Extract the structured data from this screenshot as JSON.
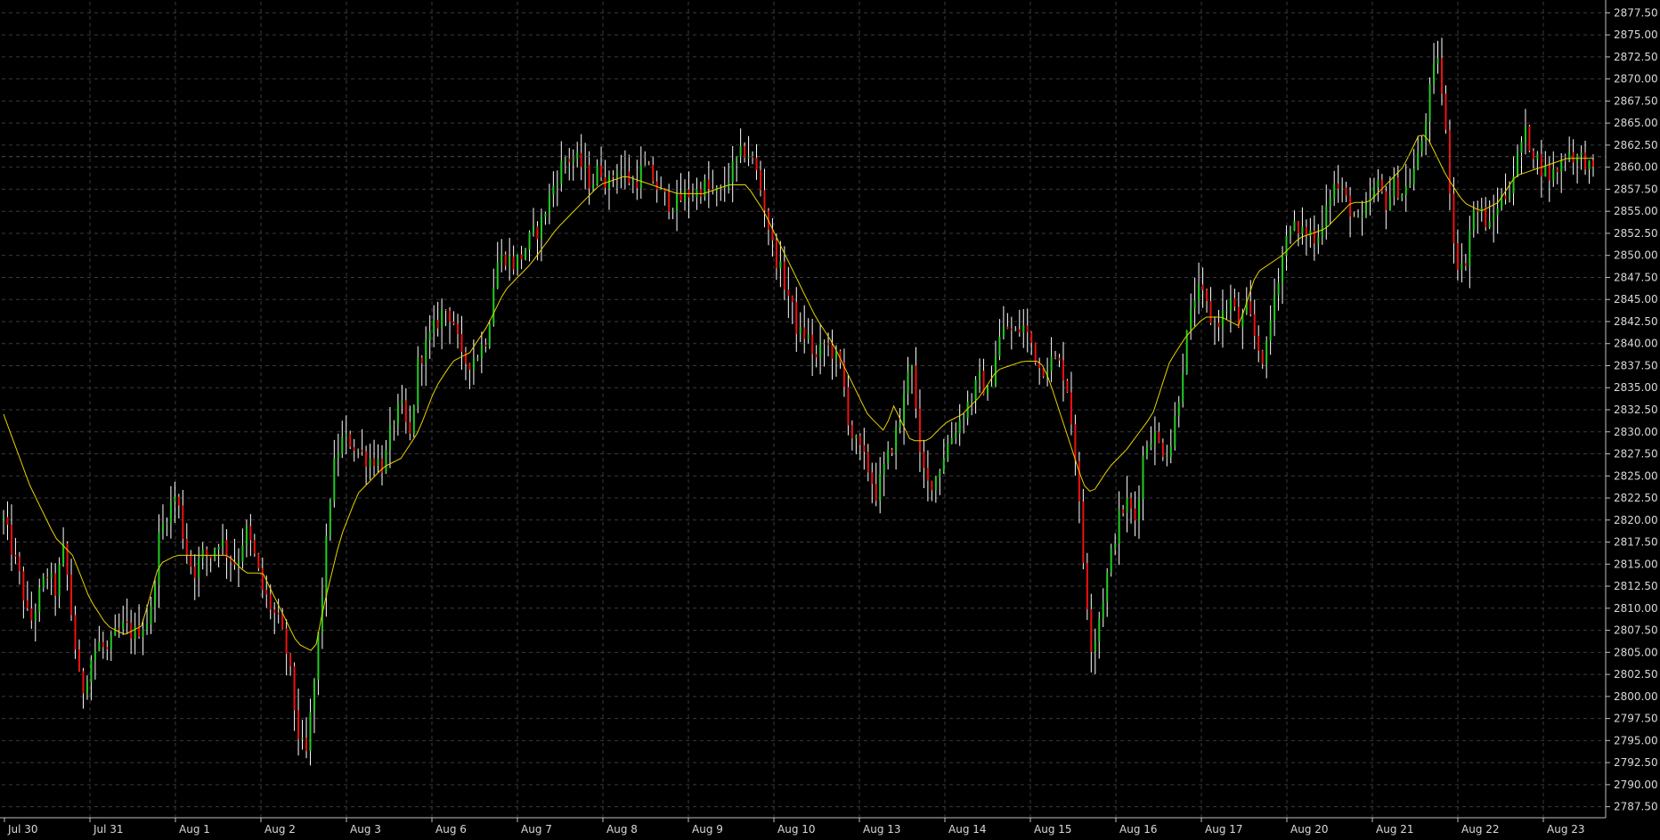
{
  "colors": {
    "background": "#000000",
    "grid": "#3a3a3a",
    "axis": "#c0c0c0",
    "text": "#d8d8d8",
    "bull_candle": "#22cc22",
    "bear_candle": "#ee1111",
    "wick": "#ffffff",
    "moving_average": "#e6d200",
    "last_price_line": "#555555"
  },
  "chart_data": {
    "type": "candlestick",
    "title": "",
    "xlabel": "",
    "ylabel": "",
    "ylim": [
      2786.25,
      2878.75
    ],
    "grid": true,
    "price_axis_side": "right",
    "last_price": 2861.2,
    "x_tick_labels": [
      "Jul 30",
      "Jul 31",
      "Aug 1",
      "Aug 2",
      "Aug 3",
      "Aug 6",
      "Aug 7",
      "Aug 8",
      "Aug 9",
      "Aug 10",
      "Aug 13",
      "Aug 14",
      "Aug 15",
      "Aug 16",
      "Aug 17",
      "Aug 20",
      "Aug 21",
      "Aug 22",
      "Aug 23"
    ],
    "y_tick_labels": [
      "2877.50",
      "2875.00",
      "2872.50",
      "2870.00",
      "2867.50",
      "2865.00",
      "2862.50",
      "2860.00",
      "2857.50",
      "2855.00",
      "2852.50",
      "2850.00",
      "2847.50",
      "2845.00",
      "2842.50",
      "2840.00",
      "2837.50",
      "2835.00",
      "2832.50",
      "2830.00",
      "2827.50",
      "2825.00",
      "2822.50",
      "2820.00",
      "2817.50",
      "2815.00",
      "2812.50",
      "2810.00",
      "2807.50",
      "2805.00",
      "2802.50",
      "2800.00",
      "2797.50",
      "2795.00",
      "2792.50",
      "2790.00",
      "2787.50"
    ],
    "y_tick_values": [
      2877.5,
      2875,
      2872.5,
      2870,
      2867.5,
      2865,
      2862.5,
      2860,
      2857.5,
      2855,
      2852.5,
      2850,
      2847.5,
      2845,
      2842.5,
      2840,
      2837.5,
      2835,
      2832.5,
      2830,
      2827.5,
      2825,
      2822.5,
      2820,
      2817.5,
      2815,
      2812.5,
      2810,
      2807.5,
      2805,
      2802.5,
      2800,
      2797.5,
      2795,
      2792.5,
      2790,
      2787.5
    ],
    "close_path": [
      [
        0,
        2820
      ],
      [
        2,
        2813
      ],
      [
        3,
        2808
      ],
      [
        5,
        2814
      ],
      [
        6,
        2812
      ],
      [
        7,
        2817
      ],
      [
        8,
        2808
      ],
      [
        9,
        2800
      ],
      [
        10,
        2804
      ],
      [
        11,
        2806
      ],
      [
        12,
        2805
      ],
      [
        13,
        2807
      ],
      [
        14,
        2808
      ],
      [
        15,
        2807
      ],
      [
        16,
        2808
      ],
      [
        17,
        2809
      ],
      [
        18,
        2818
      ],
      [
        19,
        2821
      ],
      [
        20,
        2823
      ],
      [
        21,
        2817
      ],
      [
        22,
        2814
      ],
      [
        23,
        2816
      ],
      [
        24,
        2816
      ],
      [
        25,
        2818
      ],
      [
        26,
        2816
      ],
      [
        27,
        2815
      ],
      [
        28,
        2819
      ],
      [
        29,
        2816
      ],
      [
        30,
        2812
      ],
      [
        31,
        2810
      ],
      [
        32,
        2808
      ],
      [
        33,
        2804
      ],
      [
        34,
        2796
      ],
      [
        35,
        2793
      ],
      [
        36,
        2802
      ],
      [
        37,
        2813
      ],
      [
        38,
        2825
      ],
      [
        39,
        2829
      ],
      [
        40,
        2829
      ],
      [
        41,
        2828
      ],
      [
        42,
        2827
      ],
      [
        43,
        2827
      ],
      [
        44,
        2826
      ],
      [
        45,
        2831
      ],
      [
        46,
        2833
      ],
      [
        47,
        2829
      ],
      [
        48,
        2838
      ],
      [
        49,
        2840
      ],
      [
        50,
        2842
      ],
      [
        51,
        2844
      ],
      [
        52,
        2843
      ],
      [
        53,
        2838
      ],
      [
        54,
        2838
      ],
      [
        55,
        2839
      ],
      [
        56,
        2841
      ],
      [
        57,
        2849
      ],
      [
        58,
        2850
      ],
      [
        59,
        2849
      ],
      [
        60,
        2850
      ],
      [
        61,
        2852
      ],
      [
        62,
        2853
      ],
      [
        63,
        2856
      ],
      [
        64,
        2859
      ],
      [
        65,
        2861
      ],
      [
        66,
        2861
      ],
      [
        67,
        2860
      ],
      [
        68,
        2858
      ],
      [
        69,
        2860
      ],
      [
        70,
        2858
      ],
      [
        71,
        2860
      ],
      [
        72,
        2859
      ],
      [
        73,
        2858
      ],
      [
        74,
        2860
      ],
      [
        75,
        2859
      ],
      [
        76,
        2857
      ],
      [
        77,
        2856
      ],
      [
        78,
        2856
      ],
      [
        79,
        2857
      ],
      [
        80,
        2857
      ],
      [
        81,
        2858
      ],
      [
        82,
        2857
      ],
      [
        83,
        2857
      ],
      [
        84,
        2859
      ],
      [
        85,
        2861
      ],
      [
        86,
        2862
      ],
      [
        87,
        2860
      ],
      [
        88,
        2856
      ],
      [
        89,
        2851
      ],
      [
        90,
        2848
      ],
      [
        91,
        2845
      ],
      [
        92,
        2841
      ],
      [
        93,
        2841
      ],
      [
        94,
        2838
      ],
      [
        95,
        2840
      ],
      [
        96,
        2839
      ],
      [
        97,
        2837
      ],
      [
        98,
        2830
      ],
      [
        99,
        2828
      ],
      [
        100,
        2826
      ],
      [
        101,
        2823
      ],
      [
        102,
        2826
      ],
      [
        103,
        2829
      ],
      [
        104,
        2832
      ],
      [
        105,
        2840
      ],
      [
        106,
        2827
      ],
      [
        107,
        2824
      ],
      [
        108,
        2825
      ],
      [
        109,
        2828
      ],
      [
        110,
        2830
      ],
      [
        111,
        2832
      ],
      [
        112,
        2834
      ],
      [
        113,
        2836
      ],
      [
        114,
        2834
      ],
      [
        115,
        2840
      ],
      [
        116,
        2842
      ],
      [
        117,
        2841
      ],
      [
        118,
        2842
      ],
      [
        119,
        2840
      ],
      [
        120,
        2837
      ],
      [
        121,
        2838
      ],
      [
        122,
        2838
      ],
      [
        123,
        2836
      ],
      [
        124,
        2828
      ],
      [
        125,
        2815
      ],
      [
        126,
        2805
      ],
      [
        127,
        2810
      ],
      [
        128,
        2815
      ],
      [
        129,
        2820
      ],
      [
        130,
        2822
      ],
      [
        131,
        2820
      ],
      [
        132,
        2828
      ],
      [
        133,
        2830
      ],
      [
        134,
        2828
      ],
      [
        135,
        2828
      ],
      [
        136,
        2834
      ],
      [
        137,
        2841
      ],
      [
        138,
        2846
      ],
      [
        139,
        2845
      ],
      [
        140,
        2842
      ],
      [
        141,
        2843
      ],
      [
        142,
        2845
      ],
      [
        143,
        2842
      ],
      [
        144,
        2844
      ],
      [
        145,
        2840
      ],
      [
        146,
        2838
      ],
      [
        147,
        2845
      ],
      [
        148,
        2850
      ],
      [
        149,
        2854
      ],
      [
        150,
        2852
      ],
      [
        151,
        2853
      ],
      [
        152,
        2851
      ],
      [
        153,
        2856
      ],
      [
        154,
        2858
      ],
      [
        155,
        2857
      ],
      [
        156,
        2855
      ],
      [
        157,
        2853
      ],
      [
        158,
        2856
      ],
      [
        159,
        2858
      ],
      [
        160,
        2856
      ],
      [
        161,
        2858
      ],
      [
        162,
        2857
      ],
      [
        163,
        2859
      ],
      [
        164,
        2862
      ],
      [
        165,
        2868
      ],
      [
        166,
        2873
      ],
      [
        167,
        2863
      ],
      [
        168,
        2850
      ],
      [
        169,
        2848
      ],
      [
        170,
        2855
      ],
      [
        171,
        2855
      ],
      [
        172,
        2853
      ],
      [
        173,
        2856
      ],
      [
        174,
        2857
      ],
      [
        175,
        2860
      ],
      [
        176,
        2864
      ],
      [
        177,
        2862
      ],
      [
        178,
        2860
      ],
      [
        179,
        2859
      ],
      [
        180,
        2860
      ],
      [
        181,
        2862
      ],
      [
        182,
        2861
      ],
      [
        183,
        2861
      ],
      [
        184,
        2859
      ]
    ],
    "ma_path": [
      [
        0,
        2832
      ],
      [
        3,
        2824
      ],
      [
        6,
        2818
      ],
      [
        8,
        2816
      ],
      [
        10,
        2811
      ],
      [
        12,
        2808
      ],
      [
        14,
        2807
      ],
      [
        16,
        2808
      ],
      [
        18,
        2815
      ],
      [
        20,
        2816
      ],
      [
        23,
        2816
      ],
      [
        26,
        2816
      ],
      [
        28,
        2814
      ],
      [
        30,
        2814
      ],
      [
        32,
        2810
      ],
      [
        34,
        2806
      ],
      [
        36,
        2805
      ],
      [
        37,
        2810
      ],
      [
        39,
        2818
      ],
      [
        41,
        2823
      ],
      [
        44,
        2826
      ],
      [
        46,
        2827
      ],
      [
        48,
        2830
      ],
      [
        50,
        2835
      ],
      [
        52,
        2838
      ],
      [
        54,
        2839
      ],
      [
        56,
        2842
      ],
      [
        58,
        2846
      ],
      [
        61,
        2849
      ],
      [
        64,
        2853
      ],
      [
        67,
        2856
      ],
      [
        69,
        2858
      ],
      [
        72,
        2859
      ],
      [
        75,
        2858
      ],
      [
        78,
        2857
      ],
      [
        81,
        2857
      ],
      [
        84,
        2858
      ],
      [
        86,
        2858
      ],
      [
        88,
        2855
      ],
      [
        90,
        2851
      ],
      [
        92,
        2847
      ],
      [
        94,
        2843
      ],
      [
        96,
        2840
      ],
      [
        98,
        2836
      ],
      [
        100,
        2832
      ],
      [
        102,
        2830
      ],
      [
        103,
        2833
      ],
      [
        105,
        2829
      ],
      [
        107,
        2829
      ],
      [
        109,
        2831
      ],
      [
        111,
        2832
      ],
      [
        113,
        2834
      ],
      [
        115,
        2837
      ],
      [
        118,
        2838
      ],
      [
        120,
        2838
      ],
      [
        121,
        2836
      ],
      [
        123,
        2830
      ],
      [
        125,
        2824
      ],
      [
        126,
        2823
      ],
      [
        128,
        2826
      ],
      [
        130,
        2828
      ],
      [
        133,
        2832
      ],
      [
        135,
        2838
      ],
      [
        137,
        2841
      ],
      [
        139,
        2843
      ],
      [
        141,
        2843
      ],
      [
        143,
        2842
      ],
      [
        145,
        2848
      ],
      [
        148,
        2850
      ],
      [
        150,
        2852
      ],
      [
        153,
        2853
      ],
      [
        156,
        2856
      ],
      [
        158,
        2856
      ],
      [
        160,
        2858
      ],
      [
        162,
        2860
      ],
      [
        164,
        2864
      ],
      [
        165,
        2863
      ],
      [
        167,
        2859
      ],
      [
        169,
        2856
      ],
      [
        171,
        2855
      ],
      [
        173,
        2856
      ],
      [
        175,
        2859
      ],
      [
        178,
        2860
      ],
      [
        181,
        2861
      ],
      [
        184,
        2861
      ]
    ]
  }
}
